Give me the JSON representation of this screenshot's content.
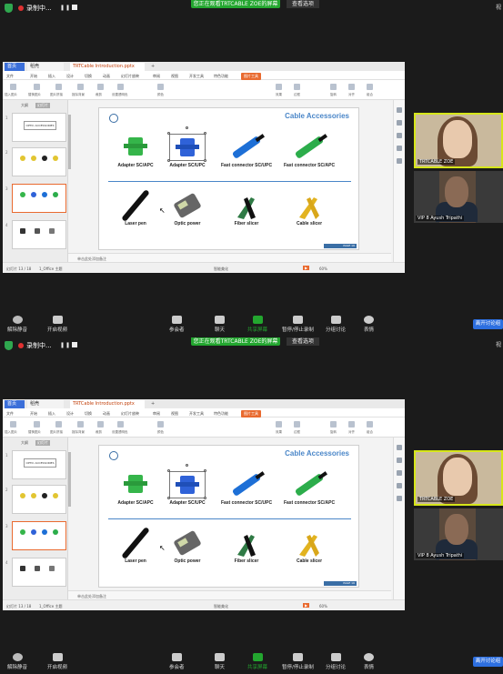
{
  "meeting": {
    "recording_label": "录制中...",
    "share_banner": "您正在观看TRTCABLE ZOE的屏幕",
    "view_options": "查看选项",
    "right_label": "视"
  },
  "ppt": {
    "tabs": {
      "home": "首页",
      "doc": "稻壳",
      "file": "TRTCable Introduction.pptx",
      "plus": "+"
    },
    "menu": [
      "文件",
      "开始",
      "插入",
      "设计",
      "切换",
      "动画",
      "幻灯片放映",
      "审阅",
      "视图",
      "开发工具",
      "特色功能"
    ],
    "menu_active": "图片工具",
    "ribbon_labels": [
      "插入图片",
      "替换图片",
      "图片拼接",
      "抠除背景",
      "裁剪",
      "设置透明色",
      "颜色",
      "效果",
      "边框",
      "旋转",
      "对齐",
      "组合"
    ],
    "thumbs_header": "大纲",
    "thumbs_tab": "幻灯片",
    "thumb_numbers": [
      "1",
      "2",
      "3",
      "4"
    ],
    "thumb_title": "OPTIC ACCESSORIES",
    "notes_placeholder": "单击此处添加备注",
    "status": {
      "slide": "幻灯片 13 / 18",
      "theme": "1_Office 主题",
      "beautify": "智能美化",
      "zoom": "60%"
    }
  },
  "slide": {
    "title": "Cable Accessories",
    "footer": "PAGE 16",
    "items": [
      {
        "label": "Adapter SC/APC",
        "color": "#35b54a"
      },
      {
        "label": "Adapter SC/UPC",
        "color": "#2f62d8"
      },
      {
        "label": "Fast connector SC/UPC",
        "color": "#1d6fd6"
      },
      {
        "label": "Fast connector SC/APC",
        "color": "#2cad4b"
      },
      {
        "label": "Laser pen",
        "color": "#111111"
      },
      {
        "label": "Optic power",
        "color": "#666666"
      },
      {
        "label": "Fiber slicer",
        "color": "#2f7a45"
      },
      {
        "label": "Cable slicer",
        "color": "#e2b320"
      }
    ]
  },
  "participants": [
    {
      "name": "TRTCABLE ZOE"
    },
    {
      "name": "VIP 8 Ayush Tripathi"
    }
  ],
  "toolbar": {
    "mute": "解除静音",
    "video": "开启视频",
    "participants": "参会者",
    "participants_count": "5",
    "chat": "聊天",
    "share": "共享屏幕",
    "pause_recording": "暂停/停止录制",
    "breakout": "分组讨论",
    "reactions": "表情",
    "leave": "离开讨论组"
  }
}
